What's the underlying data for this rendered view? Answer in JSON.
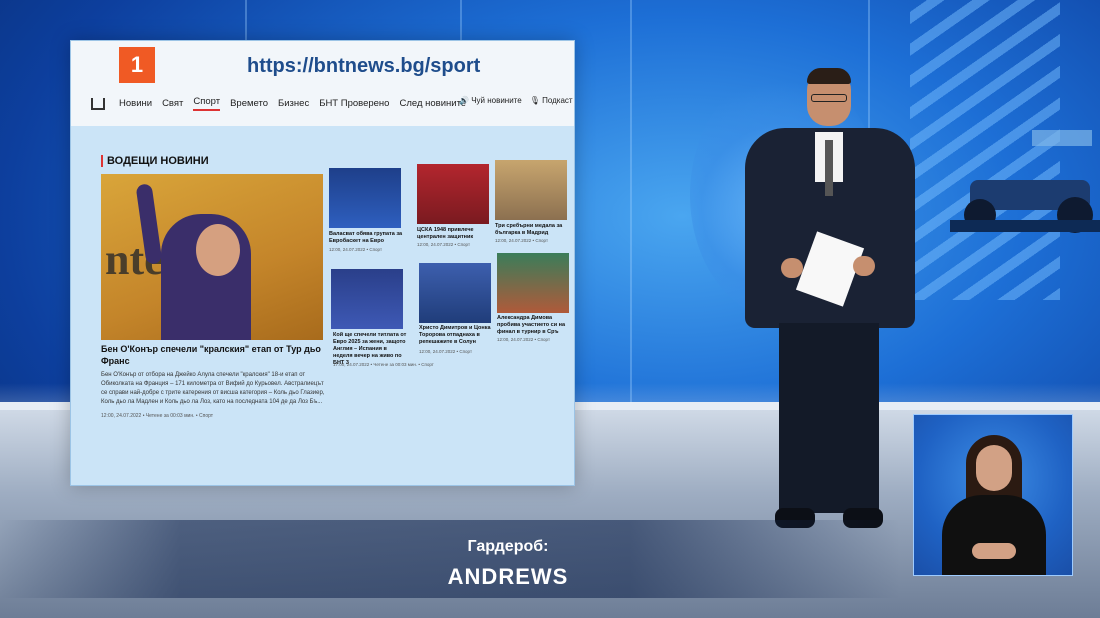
{
  "site": {
    "logo_text": "1",
    "url": "https://bntnews.bg/sport",
    "nav": [
      "Новини",
      "Свят",
      "Спорт",
      "Времето",
      "Бизнес",
      "БНТ Проверено",
      "След новините"
    ],
    "nav_active": "Спорт",
    "nav_right": [
      "Чуй новините",
      "Подкаст"
    ],
    "section_title": "ВОДЕЩИ НОВИНИ",
    "main_story": {
      "photo_word": "ntel",
      "headline": "Бен О'Конър спечели \"кралския\" етап от Тур дьо Франс",
      "lead": "Бен О'Конър от отбора на Джейко Алула спечели \"кралския\" 18-и етап от Обиколката на Франция – 171 километра от Вифий до Курьовел. Австралиецът се справи най-добре с трите катерения от висша категория – Коль дьо Глазиер, Коль дьо ла Мадлен и Коль дьо ла Лоз, като на последната 104 де да Лоз Бъ...",
      "meta": "12:00, 24.07.2022 • Четене за 00:03 мин. • Спорт"
    },
    "thumbs": [
      {
        "title": "Валасват обява групата за Евробаскет на Евро",
        "meta": "12:00, 24.07.2022 • Спорт"
      },
      {
        "title": "ЦСКА 1948 привлече централен защитник",
        "meta": "12:00, 24.07.2022 • Спорт"
      },
      {
        "title": "Три сребърни медала за българка в Мадрид",
        "meta": "12:00, 24.07.2022 • Спорт"
      },
      {
        "title": "Кой ще спечели титлата от Евро 2025 за жени, защото Англия – Испания в неделя вечер на живо по БНТ 3",
        "meta": "17:00, 24.07.2022 • Четене за 00:03 мин. • Спорт"
      },
      {
        "title": "Христо Димитров и Цонка Торорова отпаднаха в репешажите в Солун",
        "meta": "12:00, 24.07.2022 • Спорт"
      },
      {
        "title": "Александра Димова пробива участието си на финал в турнир в Сръ",
        "meta": "12:00, 24.07.2022 • Спорт"
      }
    ]
  },
  "caption": {
    "label": "Гардероб:",
    "name": "ANDREWS"
  },
  "colors": {
    "logo_orange": "#f05a24",
    "url_blue": "#1f4d8c",
    "studio_blue": "#1d6fd6"
  }
}
